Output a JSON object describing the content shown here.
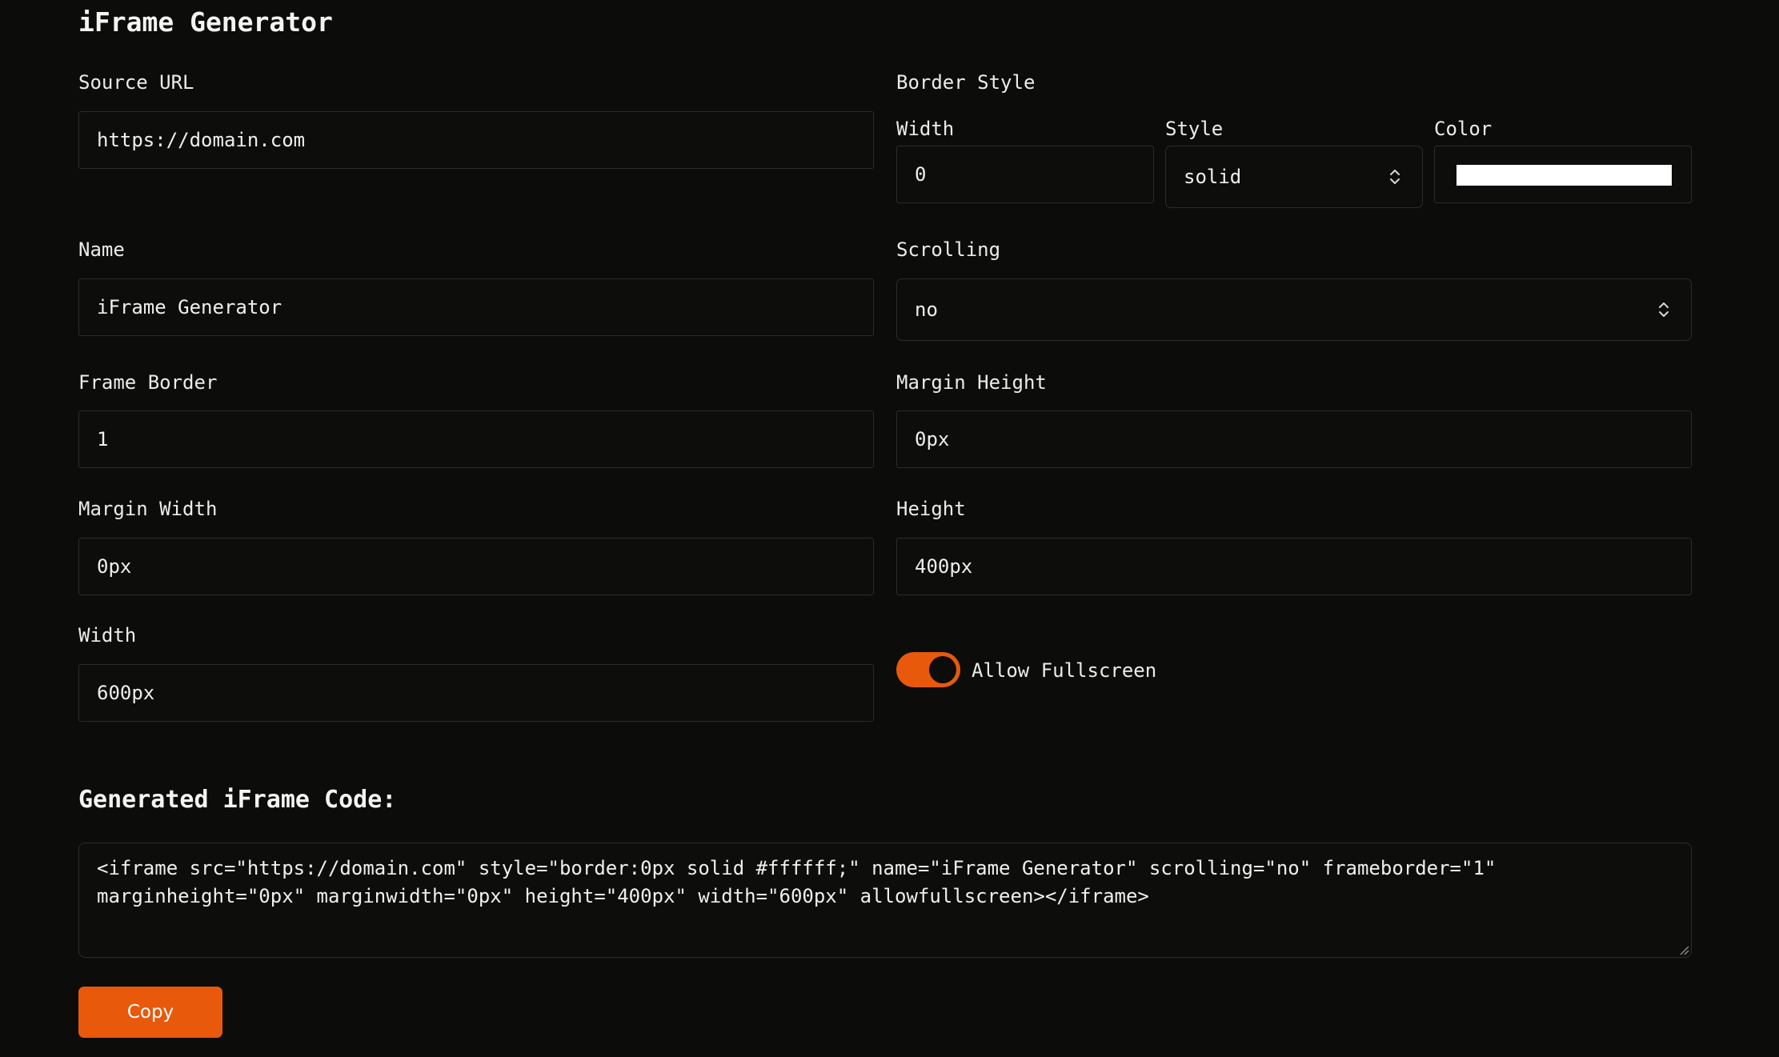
{
  "page": {
    "title": "iFrame Generator"
  },
  "form": {
    "source_url": {
      "label": "Source URL",
      "value": "https://domain.com"
    },
    "name": {
      "label": "Name",
      "value": "iFrame Generator"
    },
    "frame_border": {
      "label": "Frame Border",
      "value": "1"
    },
    "margin_width": {
      "label": "Margin Width",
      "value": "0px"
    },
    "width": {
      "label": "Width",
      "value": "600px"
    },
    "border_style": {
      "label": "Border Style",
      "width_label": "Width",
      "width_value": "0",
      "style_label": "Style",
      "style_value": "solid",
      "color_label": "Color",
      "color_value": "#ffffff"
    },
    "scrolling": {
      "label": "Scrolling",
      "value": "no"
    },
    "margin_height": {
      "label": "Margin Height",
      "value": "0px"
    },
    "height": {
      "label": "Height",
      "value": "400px"
    },
    "allow_fullscreen": {
      "label": "Allow Fullscreen",
      "checked": true
    }
  },
  "output": {
    "title": "Generated iFrame Code:",
    "code": "<iframe src=\"https://domain.com\" style=\"border:0px solid #ffffff;\" name=\"iFrame Generator\" scrolling=\"no\" frameborder=\"1\" marginheight=\"0px\" marginwidth=\"0px\" height=\"400px\" width=\"600px\" allowfullscreen></iframe>",
    "copy_label": "Copy"
  },
  "colors": {
    "background": "#0c0c0a",
    "accent": "#e8590c",
    "border": "#2c2c28",
    "text": "#f0f0ee"
  },
  "icons": {
    "select_arrows": "chevron-up-down-icon",
    "resize": "resize-grip-icon"
  }
}
